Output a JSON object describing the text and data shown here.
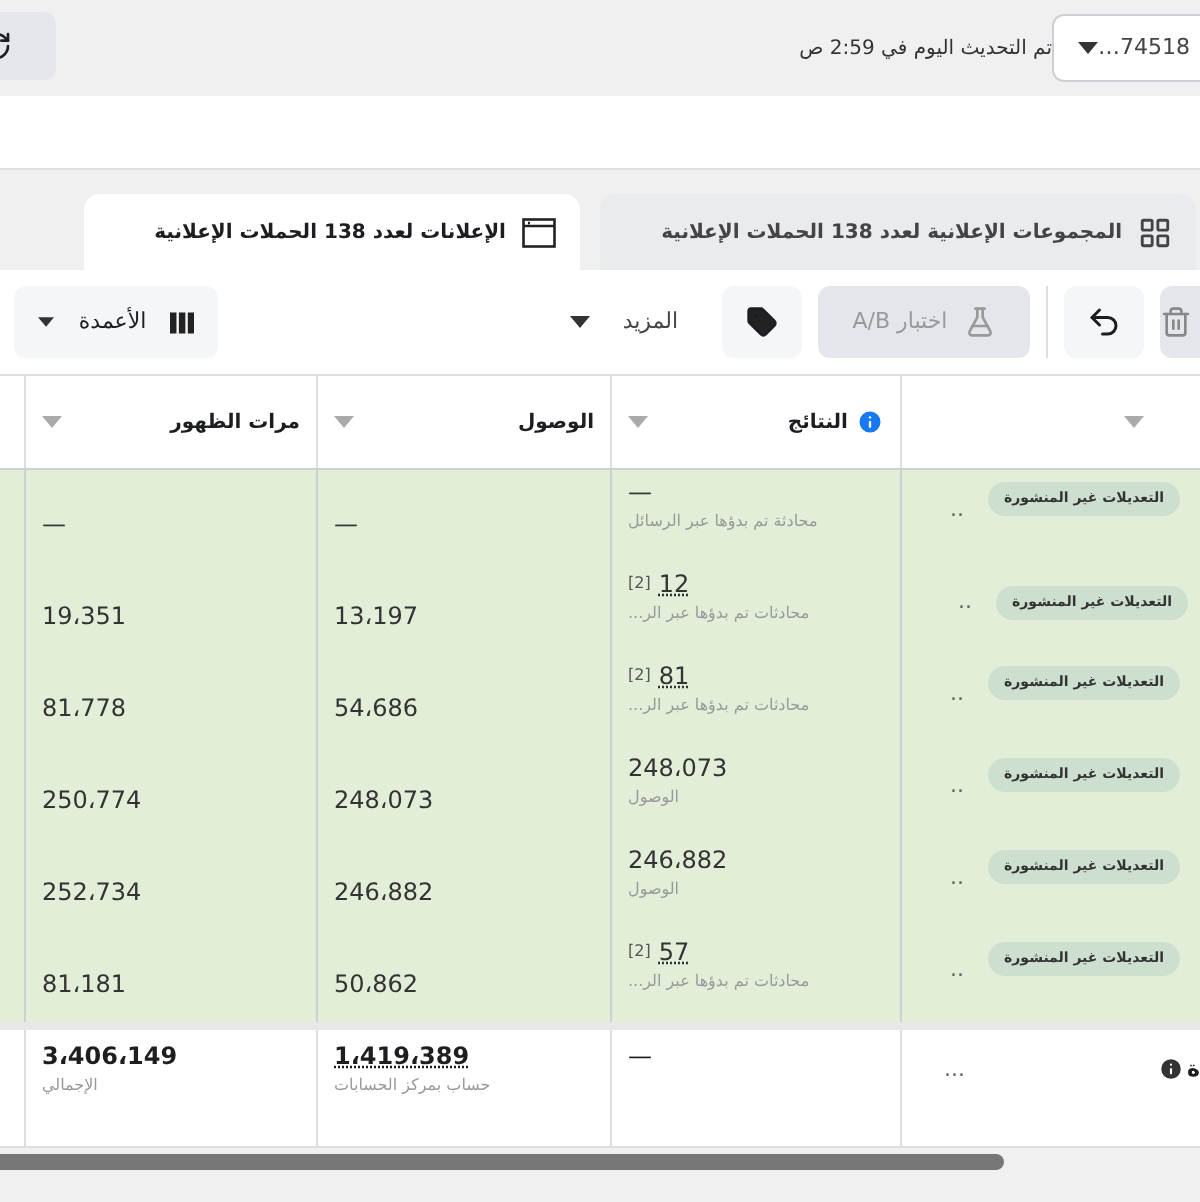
{
  "header": {
    "account": "…74518",
    "updated": "تم التحديث اليوم في 2:59 ص"
  },
  "tabs": [
    {
      "label": "المجموعات الإعلانية لعدد 138 الحملات الإعلانية",
      "selected": false,
      "kind": "grid"
    },
    {
      "label": "الإعلانات لعدد 138 الحملات الإعلانية",
      "selected": true,
      "kind": "window"
    }
  ],
  "toolbar": {
    "ab_test": {
      "label": "اختبار A/B",
      "disabled": true
    },
    "more": "المزيد",
    "columns": "الأعمدة"
  },
  "table": {
    "columns": [
      {
        "label": "النتائج",
        "info": true
      },
      {
        "label": "الوصول",
        "info": false
      },
      {
        "label": "مرات الظهور",
        "info": false
      }
    ],
    "rows": [
      {
        "badge": "التعديلات غير المنشورة",
        "dots": "..",
        "results": "—",
        "note": "",
        "results_sub": "محادثة تم بدؤها عبر الرسائل",
        "reach": "—",
        "impressions": "—"
      },
      {
        "badge": "التعديلات غير المنشورة",
        "dots": "..",
        "results": "12",
        "note": "[2]",
        "results_sub": "محادثات تم بدؤها عبر الر...",
        "reach": "13،197",
        "impressions": "19،351"
      },
      {
        "badge": "التعديلات غير المنشورة",
        "dots": "..",
        "results": "81",
        "note": "[2]",
        "results_sub": "محادثات تم بدؤها عبر الر...",
        "reach": "54،686",
        "impressions": "81،778"
      },
      {
        "badge": "التعديلات غير المنشورة",
        "dots": "..",
        "results": "248،073",
        "note": "",
        "results_sub": "الوصول",
        "reach": "248،073",
        "impressions": "250،774"
      },
      {
        "badge": "التعديلات غير المنشورة",
        "dots": "..",
        "results": "246،882",
        "note": "",
        "results_sub": "الوصول",
        "reach": "246،882",
        "impressions": "252،734"
      },
      {
        "badge": "التعديلات غير المنشورة",
        "dots": "..",
        "results": "57",
        "note": "[2]",
        "results_sub": "محادثات تم بدؤها عبر الر...",
        "reach": "50،862",
        "impressions": "81،181"
      }
    ],
    "footer": {
      "label": "ة",
      "dots": "...",
      "results": "—",
      "reach": "1،419،389",
      "reach_sub": "حساب بمركز الحسابات",
      "impressions": "3،406،149",
      "impressions_sub": "الإجمالي"
    }
  }
}
